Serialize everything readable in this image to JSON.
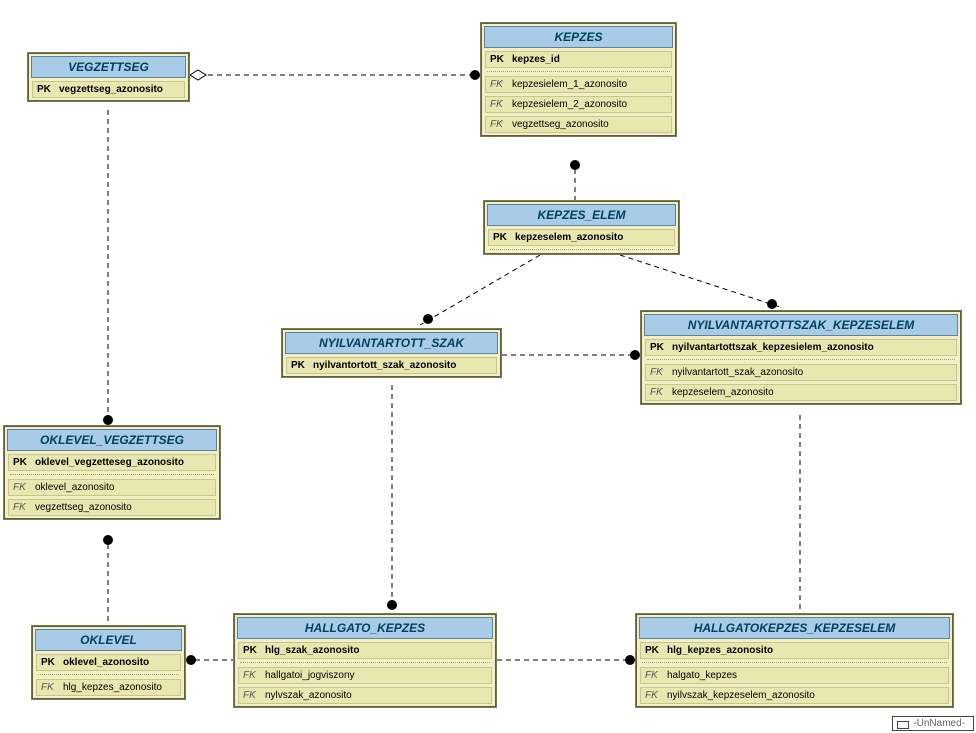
{
  "entities": {
    "vegzettseg": {
      "title": "VEGZETTSEG",
      "pk": [
        {
          "label": "vegzettseg_azonosito"
        }
      ],
      "fk": []
    },
    "kepzes": {
      "title": "KEPZES",
      "pk": [
        {
          "label": "kepzes_id"
        }
      ],
      "fk": [
        {
          "label": "kepzesielem_1_azonosito"
        },
        {
          "label": "kepzesielem_2_azonosito"
        },
        {
          "label": "vegzettseg_azonosito"
        }
      ]
    },
    "kepzes_elem": {
      "title": "KEPZES_ELEM",
      "pk": [
        {
          "label": "kepzeselem_azonosito"
        }
      ],
      "fk": []
    },
    "nyilvantartott_szak": {
      "title": "NYILVANTARTOTT_SZAK",
      "pk": [
        {
          "label": "nyilvantortott_szak_azonosito"
        }
      ],
      "fk": []
    },
    "nyilvantartottszak_kepzeselem": {
      "title": "NYILVANTARTOTTSZAK_KEPZESELEM",
      "pk": [
        {
          "label": "nyilvantartottszak_kepzesielem_azonosito"
        }
      ],
      "fk": [
        {
          "label": "nyilvantartott_szak_azonosito"
        },
        {
          "label": "kepzeselem_azonosito"
        }
      ]
    },
    "oklevel_vegzettseg": {
      "title": "OKLEVEL_VEGZETTSEG",
      "pk": [
        {
          "label": "oklevel_vegzetteseg_azonosito"
        }
      ],
      "fk": [
        {
          "label": "oklevel_azonosito"
        },
        {
          "label": "vegzettseg_azonosito"
        }
      ]
    },
    "hallgato_kepzes": {
      "title": "HALLGATO_KEPZES",
      "pk": [
        {
          "label": "hlg_szak_azonosito"
        }
      ],
      "fk": [
        {
          "label": "hallgatoi_jogviszony"
        },
        {
          "label": "nylvszak_azonosito"
        }
      ]
    },
    "hallgatokepzes_kepzeselem": {
      "title": "HALLGATOKEPZES_KEPZESELEM",
      "pk": [
        {
          "label": "hlg_kepzes_azonosito"
        }
      ],
      "fk": [
        {
          "label": "halgato_kepzes"
        },
        {
          "label": "nyilvszak_kepzeselem_azonosito"
        }
      ]
    },
    "oklevel": {
      "title": "OKLEVEL",
      "pk": [
        {
          "label": "oklevel_azonosito"
        }
      ],
      "fk": [
        {
          "label": "hlg_kepzes_azonosito"
        }
      ]
    }
  },
  "watermark": "-UnNamed-",
  "key_labels": {
    "pk": "PK",
    "fk": "FK"
  },
  "chart_data": {
    "type": "er-diagram",
    "entities": [
      "VEGZETTSEG",
      "KEPZES",
      "KEPZES_ELEM",
      "NYILVANTARTOTT_SZAK",
      "NYILVANTARTOTTSZAK_KEPZESELEM",
      "OKLEVEL_VEGZETTSEG",
      "HALLGATO_KEPZES",
      "HALLGATOKEPZES_KEPZESELEM",
      "OKLEVEL"
    ],
    "relationships": [
      {
        "from": "VEGZETTSEG",
        "to": "KEPZES",
        "from_end": "diamond",
        "to_end": "dot"
      },
      {
        "from": "VEGZETTSEG",
        "to": "OKLEVEL_VEGZETTSEG",
        "to_end": "dot"
      },
      {
        "from": "KEPZES",
        "to": "KEPZES_ELEM",
        "from_end": "dot"
      },
      {
        "from": "KEPZES_ELEM",
        "to": "NYILVANTARTOTT_SZAK",
        "to_end": "dot"
      },
      {
        "from": "KEPZES_ELEM",
        "to": "NYILVANTARTOTTSZAK_KEPZESELEM",
        "to_end": "dot"
      },
      {
        "from": "NYILVANTARTOTT_SZAK",
        "to": "NYILVANTARTOTTSZAK_KEPZESELEM",
        "to_end": "dot"
      },
      {
        "from": "NYILVANTARTOTT_SZAK",
        "to": "HALLGATO_KEPZES",
        "to_end": "dot"
      },
      {
        "from": "NYILVANTARTOTTSZAK_KEPZESELEM",
        "to": "HALLGATOKEPZES_KEPZESELEM"
      },
      {
        "from": "HALLGATO_KEPZES",
        "to": "HALLGATOKEPZES_KEPZESELEM",
        "to_end": "dot"
      },
      {
        "from": "OKLEVEL_VEGZETTSEG",
        "to": "OKLEVEL",
        "from_end": "dot"
      },
      {
        "from": "OKLEVEL",
        "to": "HALLGATO_KEPZES",
        "from_end": "dot"
      }
    ]
  }
}
